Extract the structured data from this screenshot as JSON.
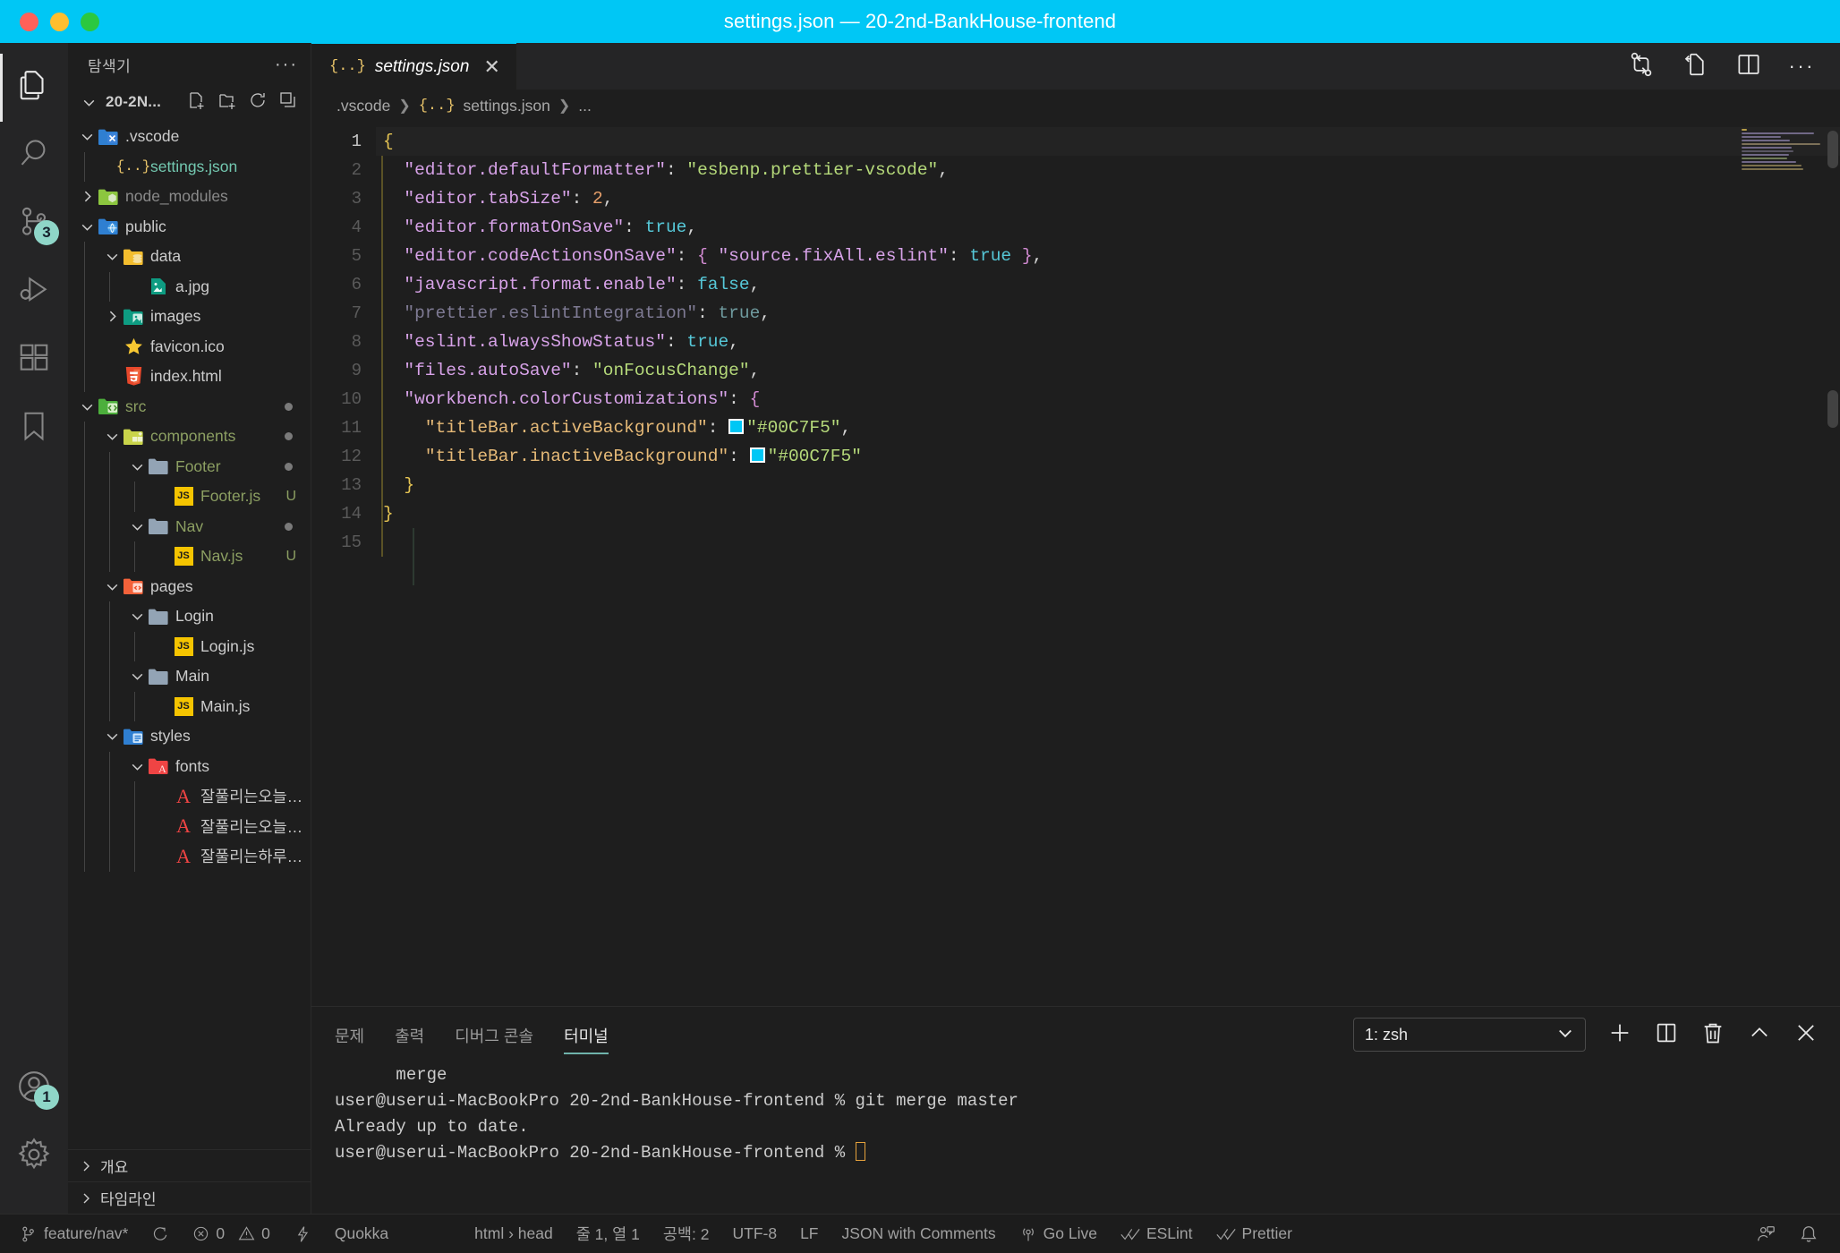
{
  "window": {
    "title": "settings.json — 20-2nd-BankHouse-frontend",
    "accent_color": "#00C7F5"
  },
  "activity_bar": {
    "items": [
      {
        "name": "explorer",
        "icon": "files-icon",
        "active": true,
        "badge": null
      },
      {
        "name": "search",
        "icon": "search-icon",
        "active": false,
        "badge": null
      },
      {
        "name": "source-control",
        "icon": "source-control-icon",
        "active": false,
        "badge": "3"
      },
      {
        "name": "run-debug",
        "icon": "run-debug-icon",
        "active": false,
        "badge": null
      },
      {
        "name": "extensions",
        "icon": "extensions-icon",
        "active": false,
        "badge": null
      },
      {
        "name": "bookmarks",
        "icon": "bookmark-icon",
        "active": false,
        "badge": null
      }
    ],
    "bottom": [
      {
        "name": "accounts",
        "icon": "account-icon",
        "badge": "1"
      },
      {
        "name": "manage",
        "icon": "gear-icon",
        "badge": null
      }
    ]
  },
  "sidebar": {
    "header_title": "탐색기",
    "more_actions": "···",
    "root_name": "20-2N...",
    "root_actions": [
      "new-file-icon",
      "new-folder-icon",
      "refresh-icon",
      "collapse-all-icon"
    ],
    "tree": [
      {
        "label": ".vscode",
        "indent": 1,
        "type": "folder",
        "icon": "folder-vscode",
        "expanded": true,
        "color": "#cccccc"
      },
      {
        "label": "settings.json",
        "indent": 2,
        "type": "file",
        "icon": "json-icon",
        "expanded": null,
        "color": "#73c8b0"
      },
      {
        "label": "node_modules",
        "indent": 1,
        "type": "folder",
        "icon": "folder-node",
        "expanded": false,
        "color": "#8a8a8a"
      },
      {
        "label": "public",
        "indent": 1,
        "type": "folder",
        "icon": "folder-public",
        "expanded": true,
        "color": "#cccccc"
      },
      {
        "label": "data",
        "indent": 2,
        "type": "folder",
        "icon": "folder-data",
        "expanded": true,
        "color": "#cccccc"
      },
      {
        "label": "a.jpg",
        "indent": 3,
        "type": "file",
        "icon": "image-icon",
        "expanded": null,
        "color": "#cccccc"
      },
      {
        "label": "images",
        "indent": 2,
        "type": "folder",
        "icon": "folder-images",
        "expanded": false,
        "color": "#cccccc"
      },
      {
        "label": "favicon.ico",
        "indent": 2,
        "type": "file",
        "icon": "favicon-icon",
        "expanded": null,
        "color": "#cccccc"
      },
      {
        "label": "index.html",
        "indent": 2,
        "type": "file",
        "icon": "html-icon",
        "expanded": null,
        "color": "#cccccc"
      },
      {
        "label": "src",
        "indent": 1,
        "type": "folder",
        "icon": "folder-src",
        "expanded": true,
        "color": "#8c9f62",
        "modified": true
      },
      {
        "label": "components",
        "indent": 2,
        "type": "folder",
        "icon": "folder-comp",
        "expanded": true,
        "color": "#8c9f62",
        "modified": true
      },
      {
        "label": "Footer",
        "indent": 3,
        "type": "folder",
        "icon": "folder-plain",
        "expanded": true,
        "color": "#8c9f62",
        "modified": true
      },
      {
        "label": "Footer.js",
        "indent": 4,
        "type": "file",
        "icon": "js-icon",
        "expanded": null,
        "color": "#8c9f62",
        "badge": "U"
      },
      {
        "label": "Nav",
        "indent": 3,
        "type": "folder",
        "icon": "folder-plain",
        "expanded": true,
        "color": "#8c9f62",
        "modified": true
      },
      {
        "label": "Nav.js",
        "indent": 4,
        "type": "file",
        "icon": "js-icon",
        "expanded": null,
        "color": "#8c9f62",
        "badge": "U"
      },
      {
        "label": "pages",
        "indent": 2,
        "type": "folder",
        "icon": "folder-pages",
        "expanded": true,
        "color": "#cccccc"
      },
      {
        "label": "Login",
        "indent": 3,
        "type": "folder",
        "icon": "folder-plain",
        "expanded": true,
        "color": "#cccccc"
      },
      {
        "label": "Login.js",
        "indent": 4,
        "type": "file",
        "icon": "js-icon",
        "expanded": null,
        "color": "#cccccc"
      },
      {
        "label": "Main",
        "indent": 3,
        "type": "folder",
        "icon": "folder-plain",
        "expanded": true,
        "color": "#cccccc"
      },
      {
        "label": "Main.js",
        "indent": 4,
        "type": "file",
        "icon": "js-icon",
        "expanded": null,
        "color": "#cccccc"
      },
      {
        "label": "styles",
        "indent": 2,
        "type": "folder",
        "icon": "folder-styles",
        "expanded": true,
        "color": "#cccccc"
      },
      {
        "label": "fonts",
        "indent": 3,
        "type": "folder",
        "icon": "folder-fonts",
        "expanded": true,
        "color": "#cccccc"
      },
      {
        "label": "잘풀리는오늘M...",
        "indent": 4,
        "type": "file",
        "icon": "font-icon",
        "expanded": null,
        "color": "#cccccc"
      },
      {
        "label": "잘풀리는오늘O...",
        "indent": 4,
        "type": "file",
        "icon": "font-icon",
        "expanded": null,
        "color": "#cccccc"
      },
      {
        "label": "잘풀리는하루M...",
        "indent": 4,
        "type": "file",
        "icon": "font-icon",
        "expanded": null,
        "color": "#cccccc"
      }
    ],
    "sections": [
      {
        "label": "개요"
      },
      {
        "label": "타임라인"
      }
    ]
  },
  "editor": {
    "tab": {
      "label": "settings.json",
      "icon": "json-icon",
      "close": "✕",
      "dirty": false
    },
    "actions": [
      "compare-changes-icon",
      "open-changes-icon",
      "split-editor-icon",
      "more-actions-icon"
    ],
    "breadcrumb": [
      ".vscode",
      "settings.json",
      "..."
    ],
    "line_count": 15,
    "lines": [
      {
        "n": 1,
        "text": "{"
      },
      {
        "n": 2,
        "text": "  \"editor.defaultFormatter\": \"esbenp.prettier-vscode\","
      },
      {
        "n": 3,
        "text": "  \"editor.tabSize\": 2,"
      },
      {
        "n": 4,
        "text": "  \"editor.formatOnSave\": true,"
      },
      {
        "n": 5,
        "text": "  \"editor.codeActionsOnSave\": { \"source.fixAll.eslint\": true },"
      },
      {
        "n": 6,
        "text": "  \"javascript.format.enable\": false,"
      },
      {
        "n": 7,
        "text": "  \"prettier.eslintIntegration\": true,"
      },
      {
        "n": 8,
        "text": "  \"eslint.alwaysShowStatus\": true,"
      },
      {
        "n": 9,
        "text": "  \"files.autoSave\": \"onFocusChange\","
      },
      {
        "n": 10,
        "text": "  \"workbench.colorCustomizations\": {"
      },
      {
        "n": 11,
        "text": "    \"titleBar.activeBackground\": \"#00C7F5\","
      },
      {
        "n": 12,
        "text": "    \"titleBar.inactiveBackground\": \"#00C7F5\""
      },
      {
        "n": 13,
        "text": "  }"
      },
      {
        "n": 14,
        "text": "}"
      },
      {
        "n": 15,
        "text": ""
      }
    ],
    "color_swatch_value": "#00C7F5"
  },
  "panel": {
    "tabs": [
      {
        "label": "문제",
        "active": false
      },
      {
        "label": "출력",
        "active": false
      },
      {
        "label": "디버그 콘솔",
        "active": false
      },
      {
        "label": "터미널",
        "active": true
      }
    ],
    "terminal_select": "1: zsh",
    "actions": [
      "new-terminal-icon",
      "split-terminal-icon",
      "kill-terminal-icon",
      "maximize-panel-icon",
      "close-panel-icon"
    ],
    "terminal_lines": [
      "      merge",
      "user@userui-MacBookPro 20-2nd-BankHouse-frontend % git merge master",
      "Already up to date.",
      "user@userui-MacBookPro 20-2nd-BankHouse-frontend % "
    ]
  },
  "status_bar": {
    "left": [
      {
        "icon": "source-control-branch-icon",
        "label": "feature/nav*"
      },
      {
        "icon": "sync-icon",
        "label": ""
      },
      {
        "icon": "error-icon",
        "label": "0"
      },
      {
        "icon": "warning-icon",
        "label": "0"
      },
      {
        "icon": "quokka-bolt-icon",
        "label": ""
      },
      {
        "icon": null,
        "label": "Quokka"
      }
    ],
    "center": [
      {
        "icon": null,
        "label": "html › head"
      },
      {
        "icon": null,
        "label": "줄 1, 열 1"
      },
      {
        "icon": null,
        "label": "공백: 2"
      },
      {
        "icon": null,
        "label": "UTF-8"
      },
      {
        "icon": null,
        "label": "LF"
      },
      {
        "icon": null,
        "label": "JSON with Comments"
      },
      {
        "icon": "broadcast-icon",
        "label": "Go Live"
      },
      {
        "icon": "check-check-icon",
        "label": "ESLint"
      },
      {
        "icon": "check-check-icon",
        "label": "Prettier"
      }
    ],
    "right": [
      {
        "icon": "feedback-icon",
        "label": ""
      },
      {
        "icon": "bell-icon",
        "label": ""
      }
    ]
  }
}
